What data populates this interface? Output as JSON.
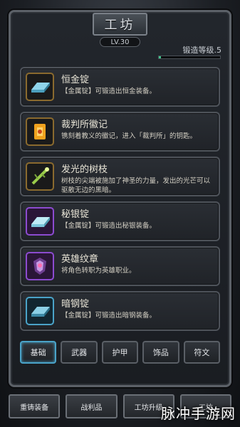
{
  "header": {
    "title": "工坊",
    "level": "LV.30",
    "forge_level_label": "锻造等级.5",
    "forge_progress": 0.04
  },
  "items": [
    {
      "name": "恒金锭",
      "desc": "【金属锭】可锻造出恒金装备。",
      "icon": "silver-ingot-icon",
      "icon_color": "#5fb7d6",
      "frame_color": "#a9813a"
    },
    {
      "name": "裁判所徽记",
      "desc": "镌刻着教义的徽记，进入「裁判所」的钥匙。",
      "icon": "emblem-icon",
      "icon_color": "#f0a21e",
      "frame_color": "#a9813a"
    },
    {
      "name": "发光的树枝",
      "desc": "树枝的尖端被施加了神圣的力量，发出的光芒可以驱散无边的黑暗。",
      "icon": "glowing-branch-icon",
      "icon_color": "#9acb4a",
      "frame_color": "#a9813a"
    },
    {
      "name": "秘银锭",
      "desc": "【金属锭】可锻造出秘银装备。",
      "icon": "mithril-ingot-icon",
      "icon_color": "#9ad8ec",
      "frame_color": "#8c4bd0"
    },
    {
      "name": "英雄纹章",
      "desc": "将角色转职为英雄职业。",
      "icon": "hero-crest-icon",
      "icon_color": "#b98ad6",
      "frame_color": "#8c4bd0"
    },
    {
      "name": "暗钢锭",
      "desc": "【金属锭】可锻造出暗钢装备。",
      "icon": "dark-steel-ingot-icon",
      "icon_color": "#6fb8d4",
      "frame_color": "#4aa3c8"
    }
  ],
  "tabs": [
    {
      "label": "基础",
      "active": true
    },
    {
      "label": "武器",
      "active": false
    },
    {
      "label": "护甲",
      "active": false
    },
    {
      "label": "饰品",
      "active": false
    },
    {
      "label": "符文",
      "active": false
    }
  ],
  "bottom_nav": [
    {
      "label": "重铸装备"
    },
    {
      "label": "战利品"
    },
    {
      "label": "工坊升级"
    },
    {
      "label": "工坊"
    }
  ],
  "watermark": "脉冲手游网"
}
